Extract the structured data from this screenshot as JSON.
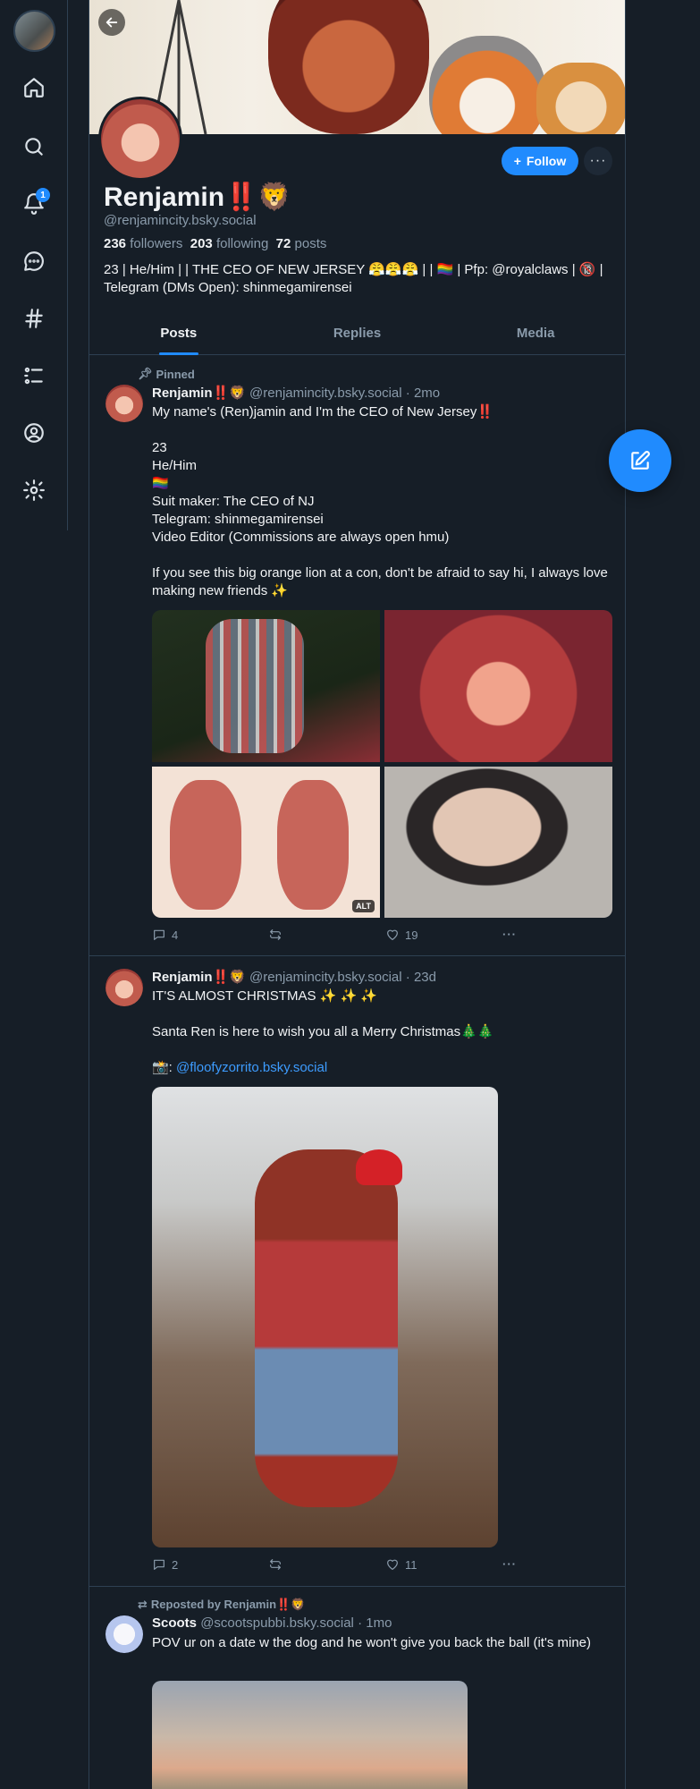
{
  "nav": {
    "notifications_badge": "1"
  },
  "profile": {
    "display_name": "Renjamin‼️🦁",
    "handle": "@renjamincity.bsky.social",
    "followers_count": "236",
    "followers_label": "followers",
    "following_count": "203",
    "following_label": "following",
    "posts_count": "72",
    "posts_label": "posts",
    "bio": "23 | He/Him | | THE CEO OF NEW JERSEY 😤😤😤 | | 🏳️‍🌈 | Pfp: @royalclaws | 🔞 | Telegram (DMs Open): shinmegamirensei",
    "follow_label": "Follow",
    "more_label": "···"
  },
  "tabs": [
    "Posts",
    "Replies",
    "Media"
  ],
  "posts": [
    {
      "meta": "Pinned",
      "name": "Renjamin‼️🦁",
      "handle": "@renjamincity.bsky.social",
      "time": "· 2mo",
      "text": "My name's (Ren)jamin and I'm the CEO of New Jersey‼️\n\n23\nHe/Him\n🏳️‍🌈\nSuit maker: The CEO of NJ\nTelegram: shinmegamirensei\nVideo Editor (Commissions are always open hmu)\n\nIf you see this big orange lion at a con, don't be afraid to say hi, I always love making new friends ✨",
      "alt_label": "ALT",
      "replies": "4",
      "likes": "19"
    },
    {
      "name": "Renjamin‼️🦁",
      "handle": "@renjamincity.bsky.social",
      "time": "· 23d",
      "text_pre": "IT'S ALMOST CHRISTMAS ✨ ✨ ✨\n\nSanta Ren is here to wish you all a Merry Christmas🎄🎄\n\n📸: ",
      "link": "@floofyzorrito.bsky.social",
      "replies": "2",
      "likes": "11"
    },
    {
      "meta": "Reposted by Renjamin‼️🦁",
      "name": "Scoots",
      "handle": "@scootspubbi.bsky.social",
      "time": "· 1mo",
      "text": "POV ur on a date w the dog and he won't give you back the ball (it's mine)"
    }
  ],
  "colors": {
    "background": "#161e27",
    "accent": "#208bfe",
    "muted": "#8a9bab",
    "border": "#2e4052"
  }
}
